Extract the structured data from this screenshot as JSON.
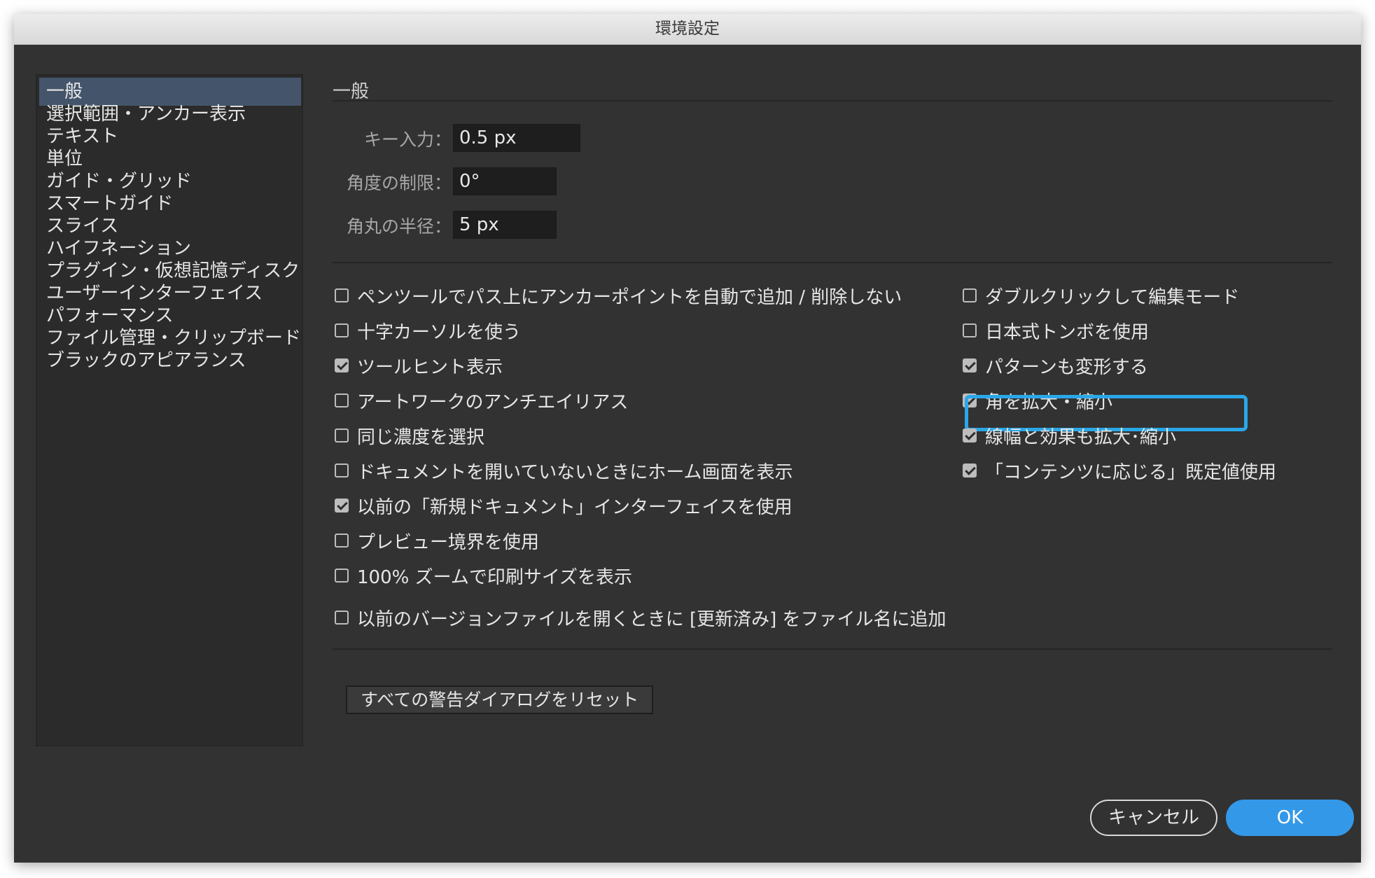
{
  "window": {
    "title": "環境設定"
  },
  "sidebar": {
    "items": [
      {
        "label": "一般",
        "selected": true
      },
      {
        "label": "選択範囲・アンカー表示"
      },
      {
        "label": "テキスト"
      },
      {
        "label": "単位"
      },
      {
        "label": "ガイド・グリッド"
      },
      {
        "label": "スマートガイド"
      },
      {
        "label": "スライス"
      },
      {
        "label": "ハイフネーション"
      },
      {
        "label": "プラグイン・仮想記憶ディスク"
      },
      {
        "label": "ユーザーインターフェイス"
      },
      {
        "label": "パフォーマンス"
      },
      {
        "label": "ファイル管理・クリップボード"
      },
      {
        "label": "ブラックのアピアランス"
      }
    ]
  },
  "main": {
    "section_title": "一般",
    "fields": {
      "key_input": {
        "label": "キー入力：",
        "value": "0.5 px"
      },
      "constrain_angle": {
        "label": "角度の制限：",
        "value": "0°"
      },
      "corner_radius": {
        "label": "角丸の半径：",
        "value": "5 px"
      }
    },
    "left_options": [
      {
        "label": "ペンツールでパス上にアンカーポイントを自動で追加 / 削除しない",
        "checked": false
      },
      {
        "label": "十字カーソルを使う",
        "checked": false
      },
      {
        "label": "ツールヒント表示",
        "checked": true
      },
      {
        "label": "アートワークのアンチエイリアス",
        "checked": false
      },
      {
        "label": "同じ濃度を選択",
        "checked": false
      },
      {
        "label": "ドキュメントを開いていないときにホーム画面を表示",
        "checked": false
      },
      {
        "label": "以前の「新規ドキュメント」インターフェイスを使用",
        "checked": true
      },
      {
        "label": "プレビュー境界を使用",
        "checked": false
      },
      {
        "label": "100% ズームで印刷サイズを表示",
        "checked": false
      }
    ],
    "right_options": [
      {
        "label": "ダブルクリックして編集モード",
        "checked": false
      },
      {
        "label": "日本式トンボを使用",
        "checked": false
      },
      {
        "label": "パターンも変形する",
        "checked": true
      },
      {
        "label": "角を拡大・縮小",
        "checked": true,
        "focused": true
      },
      {
        "label": "線幅と効果も拡大･縮小",
        "checked": true
      },
      {
        "label": "「コンテンツに応じる」既定値使用",
        "checked": true
      }
    ],
    "bottom_option": {
      "label": "以前のバージョンファイルを開くときに [更新済み] をファイル名に追加",
      "checked": false
    },
    "reset_button": "すべての警告ダイアログをリセット"
  },
  "footer": {
    "cancel_label": "キャンセル",
    "ok_label": "OK"
  },
  "colors": {
    "panel_bg": "#323232",
    "selected_item": "#44556b",
    "focus_ring": "#2aa7e8",
    "ok_button": "#3498e8"
  }
}
